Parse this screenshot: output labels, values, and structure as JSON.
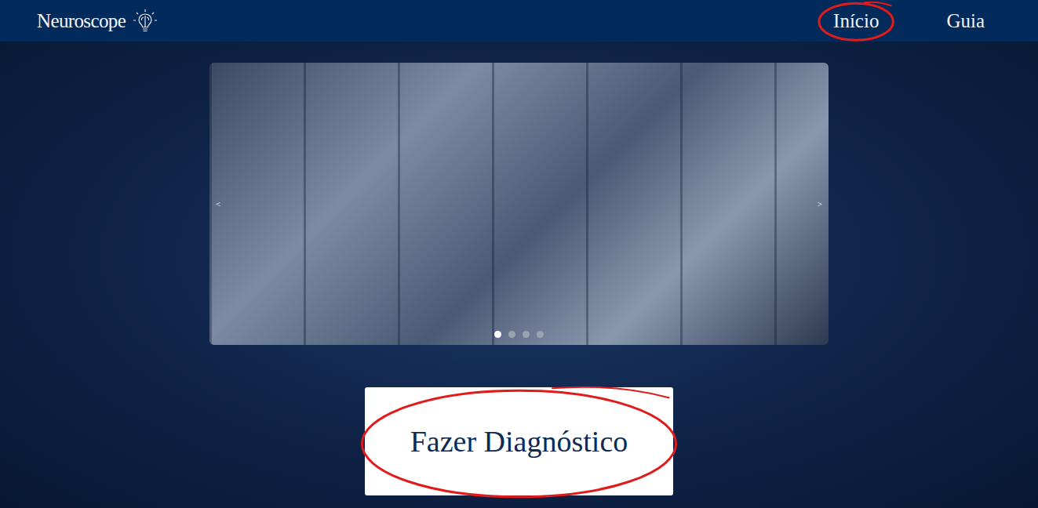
{
  "brand": {
    "name": "Neuroscope"
  },
  "nav": [
    {
      "label": "Início",
      "highlighted": true
    },
    {
      "label": "Guia",
      "highlighted": false
    }
  ],
  "carousel": {
    "prev": "<",
    "next": ">",
    "slides": [
      {
        "selected": true
      },
      {
        "selected": false
      },
      {
        "selected": false
      },
      {
        "selected": false
      }
    ]
  },
  "action": {
    "label": "Fazer Diagnóstico",
    "highlighted": true
  }
}
